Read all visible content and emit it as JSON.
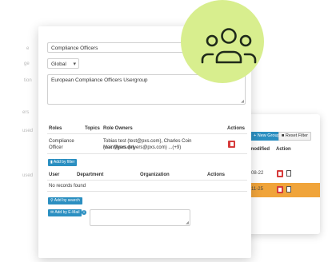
{
  "form": {
    "name_value": "Compliance Officers",
    "scope_value": "Global",
    "description_value": "European Compliance Officers Usergroup"
  },
  "roles_table": {
    "headers": [
      "Roles",
      "Topics",
      "Role Owners",
      "Actions"
    ],
    "row": {
      "role": "Compliance Officer",
      "owners_line1": "Tobias test (test@pxs.com), Charles Coin (coin@pxs.de),",
      "owners_line2": "Max Myers (myers@pxs.com) ...(+9)"
    },
    "add_filter_label": "Add by filter"
  },
  "users_table": {
    "headers": [
      "User",
      "Department",
      "Organization",
      "Actions"
    ],
    "empty_text": "No records found",
    "add_search_label": "Add by search",
    "add_email_label": "Add by E-Mail"
  },
  "back_card": {
    "new_group_label": "New Group",
    "reset_filter_label": "Reset Filter",
    "col_modified": "modified",
    "col_action": "Action",
    "rows": [
      {
        "date": "08-22",
        "highlight": false
      },
      {
        "date": "11-25",
        "highlight": true
      }
    ]
  },
  "colors": {
    "accent": "#2b8fc1",
    "danger": "#d63c3c",
    "highlight_row": "#f0a43a",
    "icon_circle": "#d8ee8e"
  },
  "icons": [
    "user-group-icon",
    "trash-icon",
    "copy-icon",
    "info-icon",
    "plus-icon"
  ]
}
